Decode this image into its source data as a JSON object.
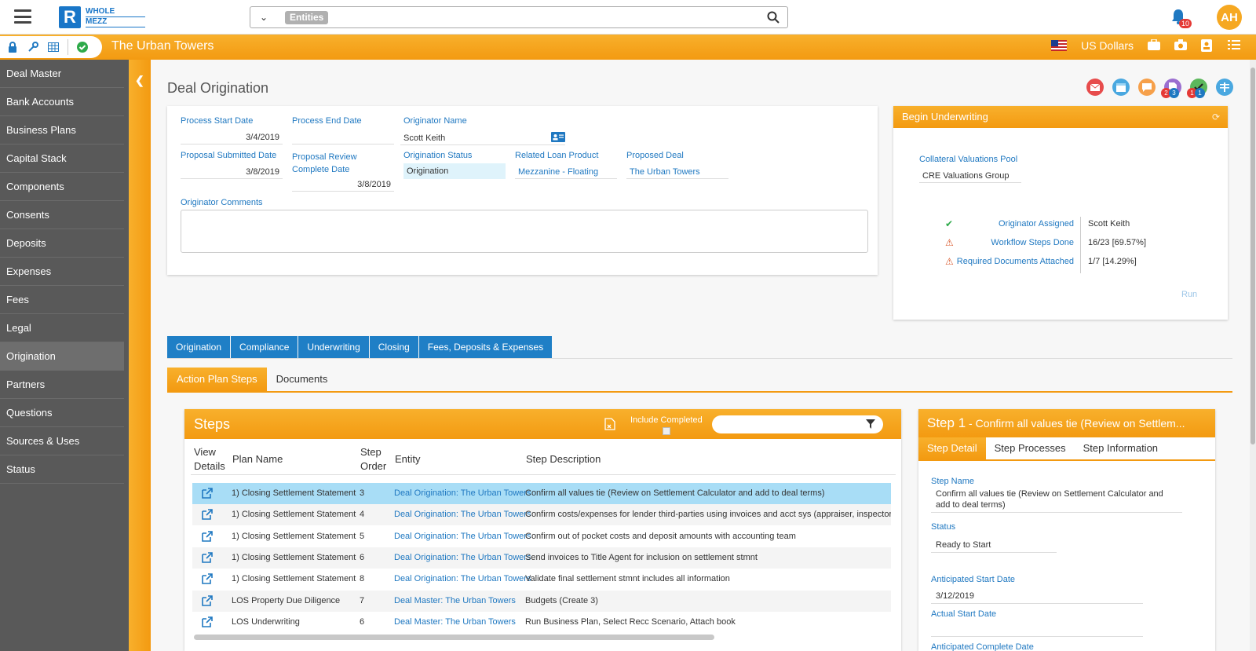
{
  "topbar": {
    "logo_letter": "R",
    "logo_line1": "WHOLE",
    "logo_line2": "MEZZ",
    "search_chip": "Entities",
    "notifications": "10",
    "avatar": "AH"
  },
  "entity_bar": {
    "title": "The Urban Towers",
    "currency": "US Dollars"
  },
  "sidebar": {
    "items": [
      "Deal Master",
      "Bank Accounts",
      "Business Plans",
      "Capital Stack",
      "Components",
      "Consents",
      "Deposits",
      "Expenses",
      "Fees",
      "Legal",
      "Origination",
      "Partners",
      "Questions",
      "Sources & Uses",
      "Status"
    ],
    "active": "Origination"
  },
  "page": {
    "title": "Deal Origination",
    "badges": [
      "2",
      "3",
      "1",
      "1"
    ]
  },
  "form": {
    "process_start_label": "Process Start Date",
    "process_start": "3/4/2019",
    "process_end_label": "Process End Date",
    "process_end": "",
    "originator_name_label": "Originator Name",
    "originator_name": "Scott Keith",
    "proposal_submitted_label": "Proposal Submitted Date",
    "proposal_submitted": "3/8/2019",
    "proposal_review_label": "Proposal Review Complete Date",
    "proposal_review": "3/8/2019",
    "origination_status_label": "Origination Status",
    "origination_status": "Origination",
    "related_loan_label": "Related Loan Product",
    "related_loan": "Mezzanine - Floating",
    "proposed_deal_label": "Proposed Deal",
    "proposed_deal": "The Urban Towers",
    "comments_label": "Originator Comments"
  },
  "underwriting": {
    "title": "Begin Underwriting",
    "pool_label": "Collateral Valuations Pool",
    "pool": "CRE Valuations Group",
    "checks": [
      {
        "label": "Originator Assigned",
        "value": "Scott Keith",
        "status": "ok"
      },
      {
        "label": "Workflow Steps Done",
        "value": "16/23 [69.57%]",
        "status": "warn"
      },
      {
        "label": "Required Documents Attached",
        "value": "1/7 [14.29%]",
        "status": "warn"
      }
    ],
    "run_label": "Run"
  },
  "tabs": [
    "Origination",
    "Compliance",
    "Underwriting",
    "Closing",
    "Fees, Deposits & Expenses"
  ],
  "subtabs": [
    "Action Plan Steps",
    "Documents"
  ],
  "steps": {
    "title": "Steps",
    "include_completed": "Include Completed",
    "columns": {
      "view1": "View",
      "view2": "Details",
      "plan": "Plan Name",
      "order1": "Step",
      "order2": "Order",
      "entity": "Entity",
      "desc": "Step Description"
    },
    "rows": [
      {
        "plan": "1) Closing Settlement Statement",
        "order": "3",
        "entity": "Deal Origination: The Urban Towers",
        "desc": "Confirm all values tie (Review on Settlement Calculator and add to deal terms)"
      },
      {
        "plan": "1) Closing Settlement Statement",
        "order": "4",
        "entity": "Deal Origination: The Urban Towers",
        "desc": "Confirm costs/expenses for lender third-parties using invoices and acct sys (appraiser, inspector"
      },
      {
        "plan": "1) Closing Settlement Statement",
        "order": "5",
        "entity": "Deal Origination: The Urban Towers",
        "desc": "Confirm out of pocket costs and deposit amounts with accounting team"
      },
      {
        "plan": "1) Closing Settlement Statement",
        "order": "6",
        "entity": "Deal Origination: The Urban Towers",
        "desc": "Send invoices to Title Agent for inclusion on settlement stmnt"
      },
      {
        "plan": "1) Closing Settlement Statement",
        "order": "8",
        "entity": "Deal Origination: The Urban Towers",
        "desc": "Validate final settlement stmnt includes all information"
      },
      {
        "plan": "LOS Property Due Diligence",
        "order": "7",
        "entity": "Deal Master: The Urban Towers",
        "desc": "Budgets (Create 3)"
      },
      {
        "plan": "LOS Underwriting",
        "order": "6",
        "entity": "Deal Master: The Urban Towers",
        "desc": "Run Business Plan, Select Recc Scenario, Attach book"
      }
    ]
  },
  "detail": {
    "title_step": "Step 1",
    "title_rest": " - Confirm all values tie (Review on Settlem...",
    "tabs": [
      "Step Detail",
      "Step Processes",
      "Step Information"
    ],
    "step_name_label": "Step Name",
    "step_name": "Confirm all values tie (Review on Settlement Calculator and add to deal terms)",
    "status_label": "Status",
    "status": "Ready to Start",
    "ant_start_label": "Anticipated Start Date",
    "ant_start": "3/12/2019",
    "act_start_label": "Actual Start Date",
    "act_start": "",
    "ant_complete_label": "Anticipated Complete Date"
  }
}
